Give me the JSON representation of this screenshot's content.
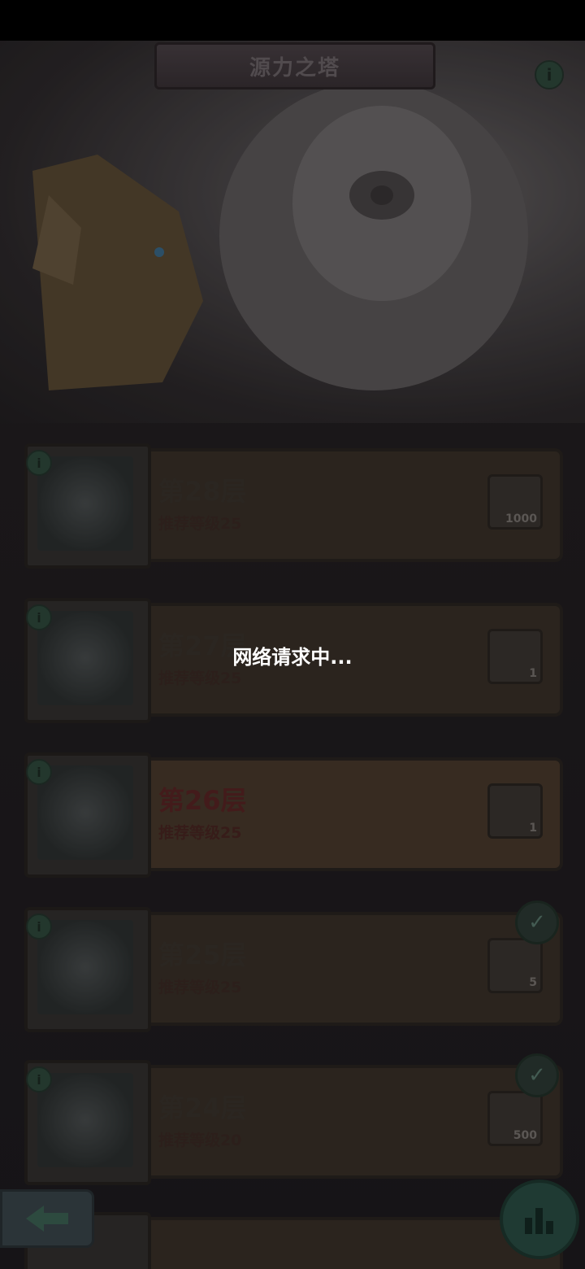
{
  "header": {
    "title": "源力之塔"
  },
  "loading": {
    "message": "网络请求中..."
  },
  "floors": [
    {
      "label": "第28层",
      "recommend": "推荐等级25",
      "reward_count": "1000",
      "cleared": false,
      "active": false
    },
    {
      "label": "第27层",
      "recommend": "推荐等级25",
      "reward_count": "1",
      "cleared": false,
      "active": false
    },
    {
      "label": "第26层",
      "recommend": "推荐等级25",
      "reward_count": "1",
      "cleared": false,
      "active": true
    },
    {
      "label": "第25层",
      "recommend": "推荐等级25",
      "reward_count": "5",
      "cleared": true,
      "active": false
    },
    {
      "label": "第24层",
      "recommend": "推荐等级20",
      "reward_count": "500",
      "cleared": true,
      "active": false
    }
  ],
  "icons": {
    "info": "info-icon",
    "check": "check-icon",
    "back": "arrow-left-icon",
    "rank": "bar-chart-icon"
  },
  "colors": {
    "accent_green": "#2f4a3d",
    "toast_text": "#ffffff"
  }
}
